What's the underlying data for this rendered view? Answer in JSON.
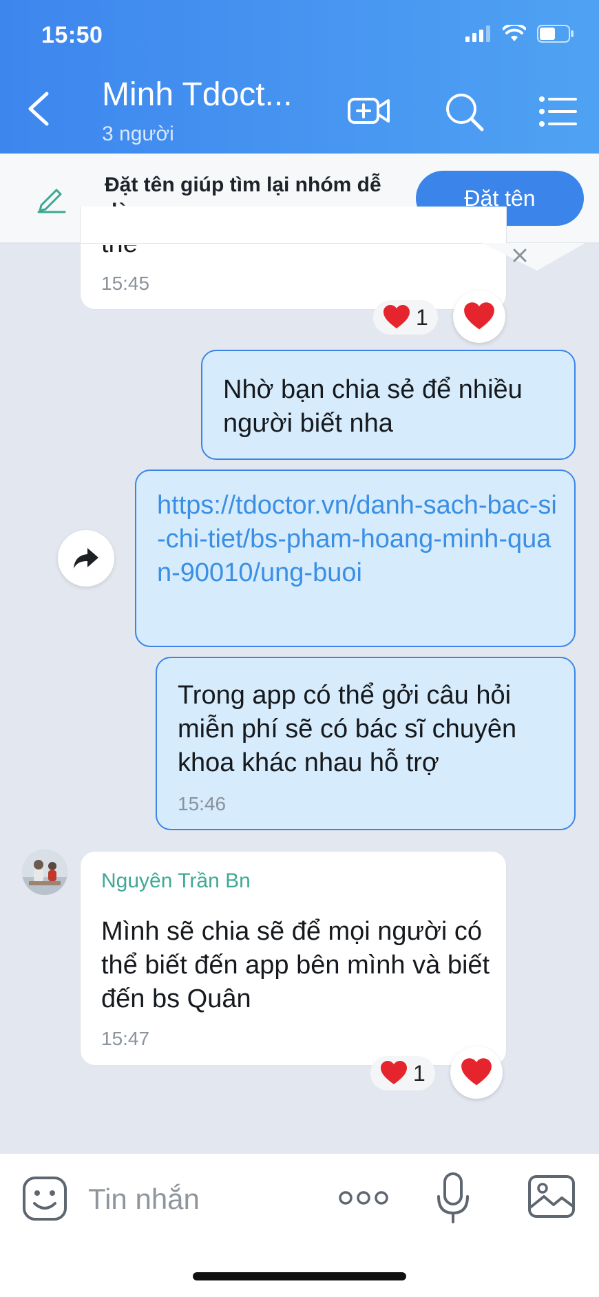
{
  "status_bar": {
    "time": "15:50"
  },
  "header": {
    "title": "Minh Tdoct...",
    "subtitle": "3 người"
  },
  "banner": {
    "text": "Đặt tên giúp tìm lại nhóm dễ dàng",
    "button_label": "Đặt tên"
  },
  "messages": [
    {
      "type": "incoming",
      "partial_text": "thể",
      "time": "15:45",
      "reaction_count": "1"
    },
    {
      "type": "outgoing",
      "text": "Nhờ bạn chia sẻ để nhiều người biết nha"
    },
    {
      "type": "outgoing",
      "link": "https://tdoctor.vn/danh-sach-bac-si-chi-tiet/bs-pham-hoang-minh-quan-90010/ung-buoi"
    },
    {
      "type": "outgoing",
      "text": "Trong app có thể gởi câu hỏi miễn phí sẽ có bác sĩ chuyên khoa khác nhau hỗ trợ",
      "time": "15:46"
    },
    {
      "type": "incoming",
      "sender": "Nguyên Trần Bn",
      "text": "Mình sẽ chia sẽ để mọi người có thể biết đến app bên mình và biết đến bs Quân",
      "time": "15:47",
      "reaction_count": "1"
    }
  ],
  "input": {
    "placeholder": "Tin nhắn"
  },
  "colors": {
    "header": "#3d86ee",
    "accent": "#3a84ea",
    "outgoing_bg": "#d6ebfb",
    "sender": "#40a896",
    "heart": "#e5242e"
  },
  "icons": [
    "back-icon",
    "video-call-add-icon",
    "search-icon",
    "menu-icon",
    "pencil-icon",
    "close-icon",
    "heart-icon",
    "share-forward-icon",
    "emoji-icon",
    "more-icon",
    "microphone-icon",
    "image-icon"
  ]
}
